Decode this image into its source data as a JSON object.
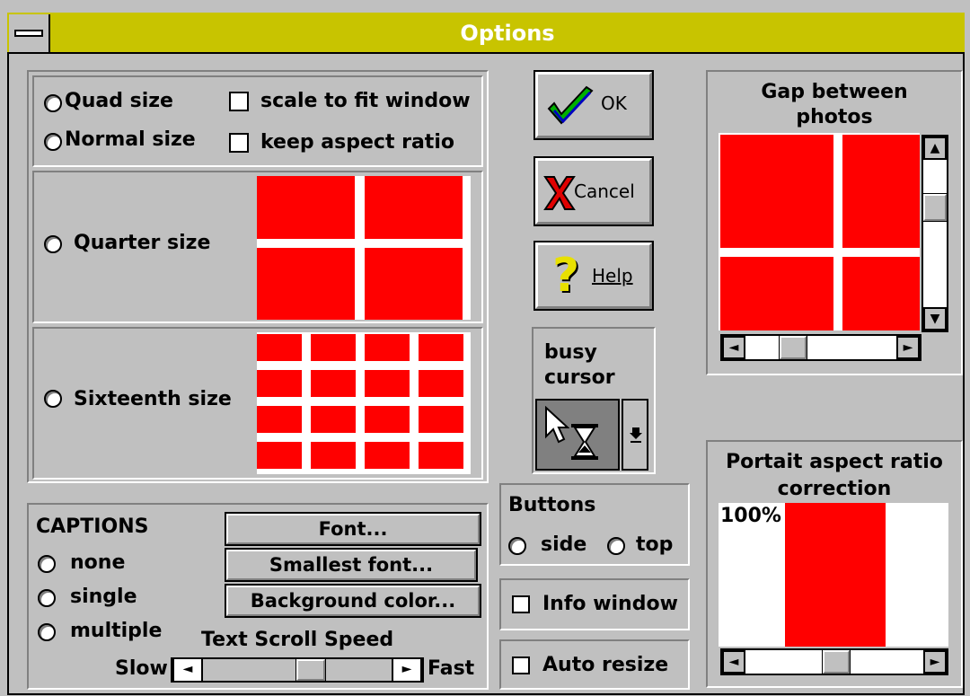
{
  "window": {
    "title": "Options"
  },
  "size_mode": {
    "quad_label": "Quad size",
    "normal_label": "Normal size",
    "quarter_label": "Quarter size",
    "sixteenth_label": "Sixteenth size",
    "scale_to_fit_label": "scale to fit window",
    "keep_aspect_label": "keep aspect ratio"
  },
  "buttons": {
    "ok_label": "OK",
    "cancel_label": "Cancel",
    "help_label": "Help"
  },
  "busy_cursor": {
    "label_line1": "busy",
    "label_line2": "cursor"
  },
  "gap": {
    "title_line1": "Gap between",
    "title_line2": "photos"
  },
  "portrait": {
    "title_line1": "Portait aspect ratio",
    "title_line2": "correction",
    "value": "100%"
  },
  "captions": {
    "heading": "CAPTIONS",
    "none_label": "none",
    "single_label": "single",
    "multiple_label": "multiple",
    "font_button": "Font...",
    "smallest_font_button": "Smallest font...",
    "background_color_button": "Background color...",
    "scroll_speed_label": "Text Scroll Speed",
    "slow_label": "Slow",
    "fast_label": "Fast"
  },
  "buttons_position": {
    "heading": "Buttons",
    "side_label": "side",
    "top_label": "top"
  },
  "info_window_label": "Info window",
  "auto_resize_label": "Auto resize",
  "colors": {
    "title_bar": "#c8c400",
    "preview": "#ff0000",
    "face": "#c0c0c0"
  }
}
